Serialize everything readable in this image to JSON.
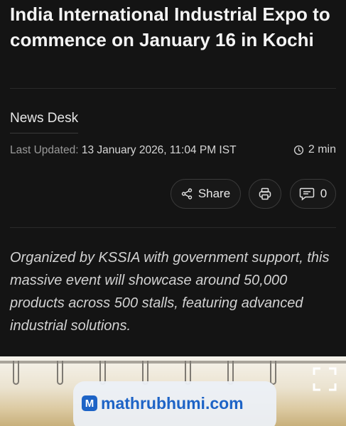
{
  "article": {
    "title": "India International Industrial Expo to commence on January 16 in Kochi",
    "author": "News Desk",
    "updated_label": "Last Updated: ",
    "updated_value": "13 January 2026, 11:04 PM IST",
    "read_time": "2 min",
    "lede": "Organized by KSSIA with government support, this massive event will showcase around 50,000 products across 500 stalls, featuring advanced industrial solutions."
  },
  "actions": {
    "share_label": "Share",
    "comment_count": "0"
  },
  "image": {
    "watermark_logo": "M",
    "watermark_text": "mathrubhumi.com"
  },
  "icons": {
    "clock": "clock-icon",
    "share": "share-icon",
    "print": "print-icon",
    "comment": "comment-icon",
    "expand": "expand-icon"
  },
  "colors": {
    "background": "#141414",
    "text": "#f2f2f2",
    "muted": "#9a9a9a",
    "watermark_blue": "#1d63c6"
  }
}
